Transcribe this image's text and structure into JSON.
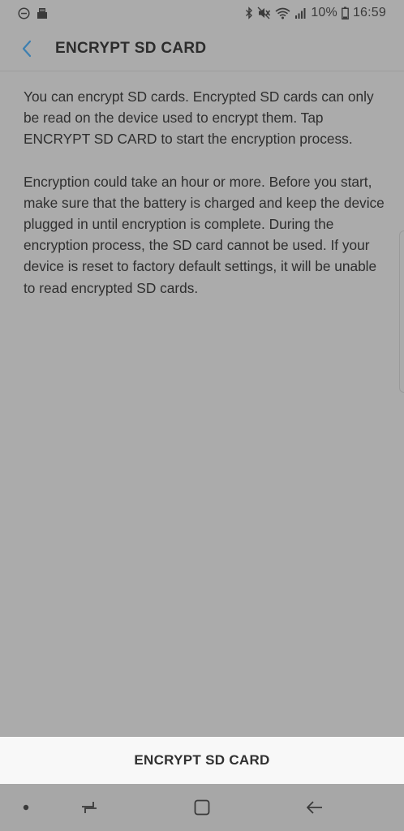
{
  "status_bar": {
    "battery_percent": "10%",
    "time": "16:59"
  },
  "header": {
    "title": "ENCRYPT SD CARD",
    "back_icon": "chevron-left-icon"
  },
  "body": {
    "paragraphs": [
      "You can encrypt SD cards. Encrypted SD cards can only be read on the device used to encrypt them. Tap ENCRYPT SD CARD to start the encryption process.",
      "Encryption could take an hour or more. Before you start, make sure that the battery is charged and keep the device plugged in until encryption is complete. During the encryption process, the SD card cannot be used. If your device is reset to factory default settings, it will be unable to read encrypted SD cards."
    ]
  },
  "action": {
    "encrypt_label": "ENCRYPT SD CARD"
  },
  "nav_bar": {
    "icons": [
      "dot-icon",
      "recent-apps-icon",
      "home-icon",
      "back-icon"
    ]
  },
  "colors": {
    "background": "#ababab",
    "button_bar": "#f8f8f8",
    "accent": "#3d7fb0",
    "text": "#2e2e2e"
  }
}
